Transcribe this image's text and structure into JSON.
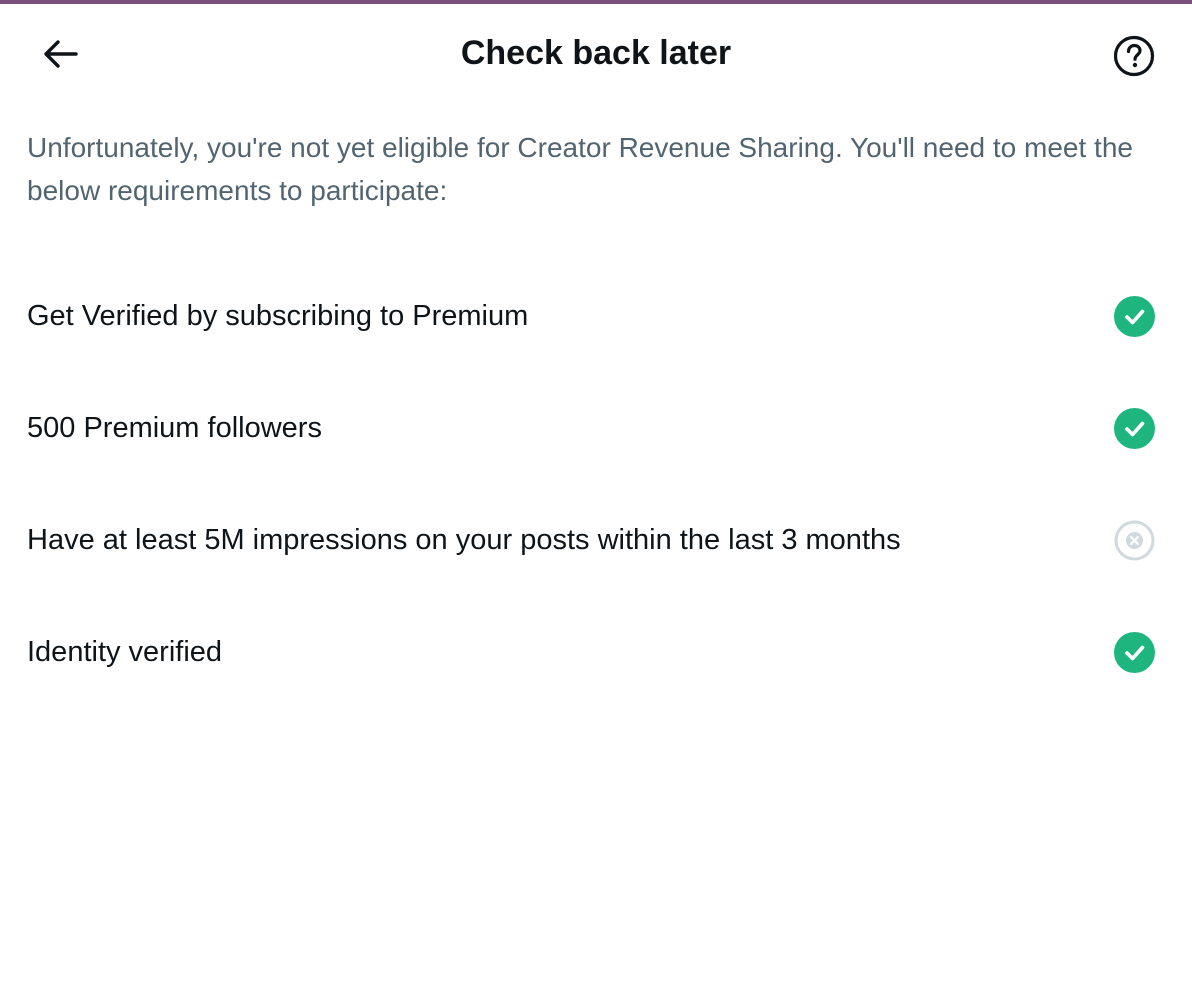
{
  "header": {
    "title": "Check back later",
    "back_icon": "arrow-left-icon",
    "help_icon": "help-circle-icon"
  },
  "intro": {
    "text": "Unfortunately, you're not yet eligible for Creator Revenue Sharing. You'll need to meet the below requirements to participate:"
  },
  "requirements": [
    {
      "label": "Get Verified by subscribing to Premium",
      "status": "met",
      "icon": "check-circle-icon"
    },
    {
      "label": "500 Premium followers",
      "status": "met",
      "icon": "check-circle-icon"
    },
    {
      "label": "Have at least 5M impressions on your posts within the last 3 months",
      "status": "not-met",
      "icon": "x-circle-icon"
    },
    {
      "label": "Identity verified",
      "status": "met",
      "icon": "check-circle-icon"
    }
  ],
  "colors": {
    "accent_bar": "#7a4f7a",
    "met": "#1fb57f",
    "not_met": "#cfd9de",
    "text_primary": "#0f1419",
    "text_secondary": "#536471"
  }
}
